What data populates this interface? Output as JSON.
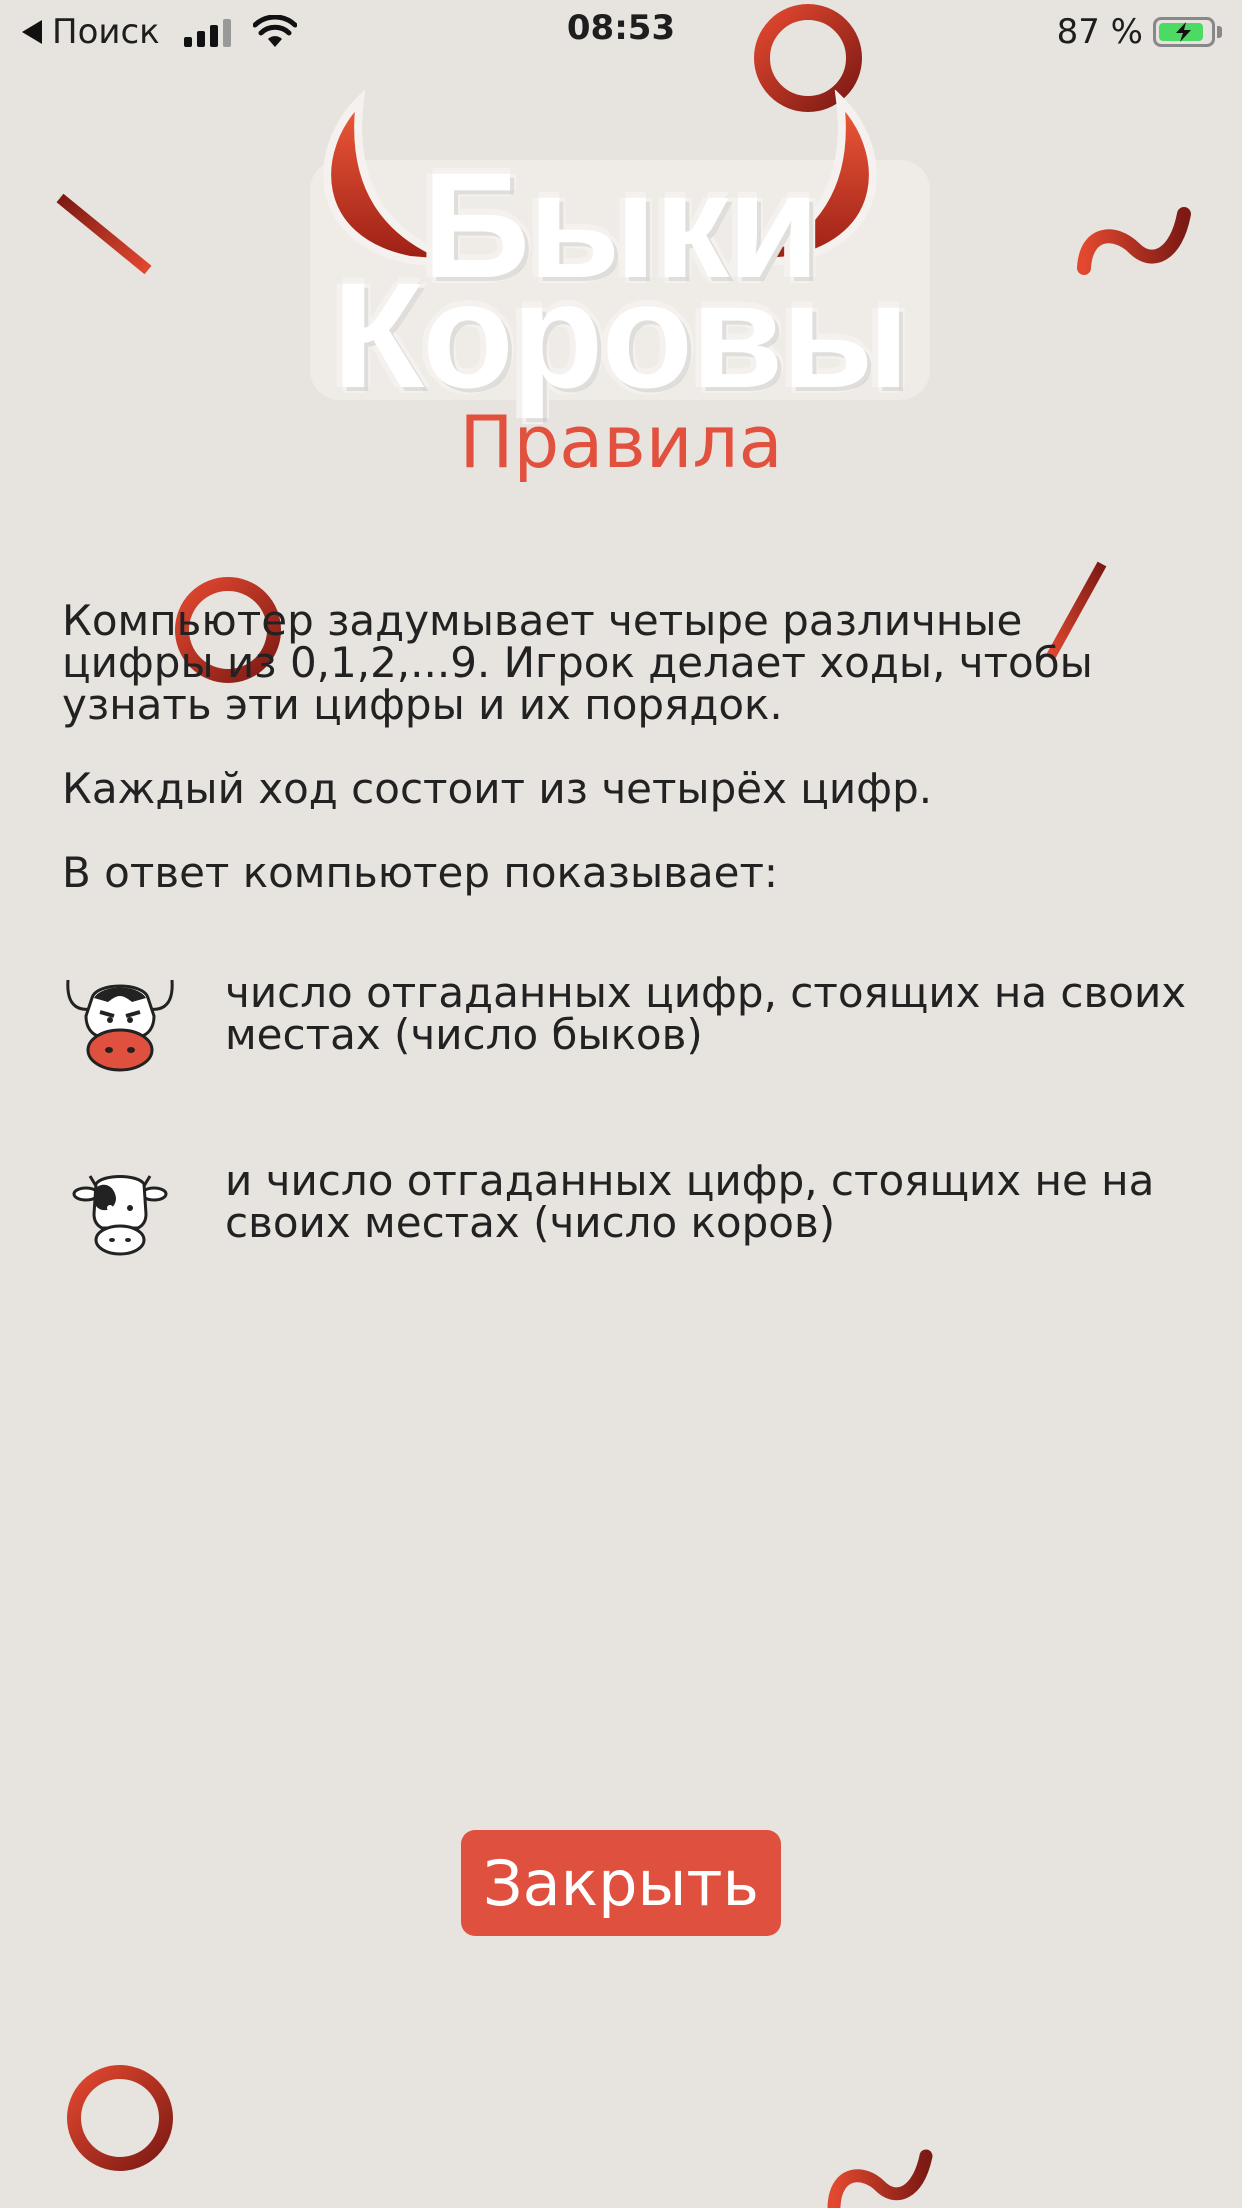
{
  "status_bar": {
    "back_label": "Поиск",
    "time": "08:53",
    "battery_text": "87 %",
    "battery_level": 0.87
  },
  "logo": {
    "line1": "Быки",
    "line2": "Коровы"
  },
  "page_title": "Правила",
  "rules": {
    "paragraph1": "Компьютер задумывает четыре различные цифры из 0,1,2,...9. Игрок делает ходы, чтобы узнать эти цифры и их порядок.",
    "paragraph2": "Каждый ход состоит из четырёх цифр.",
    "paragraph3": "В ответ компьютер показывает:"
  },
  "legend": [
    {
      "icon": "bull-icon",
      "text": "число отгаданных цифр, стоящих на своих местах (число быков)"
    },
    {
      "icon": "cow-icon",
      "text": "и число отгаданных цифр, стоящих не на своих местах (число коров)"
    }
  ],
  "close_button_label": "Закрыть",
  "colors": {
    "background": "#e7e4e0",
    "accent": "#e0503e",
    "deco_dark": "#8d1f1a"
  }
}
